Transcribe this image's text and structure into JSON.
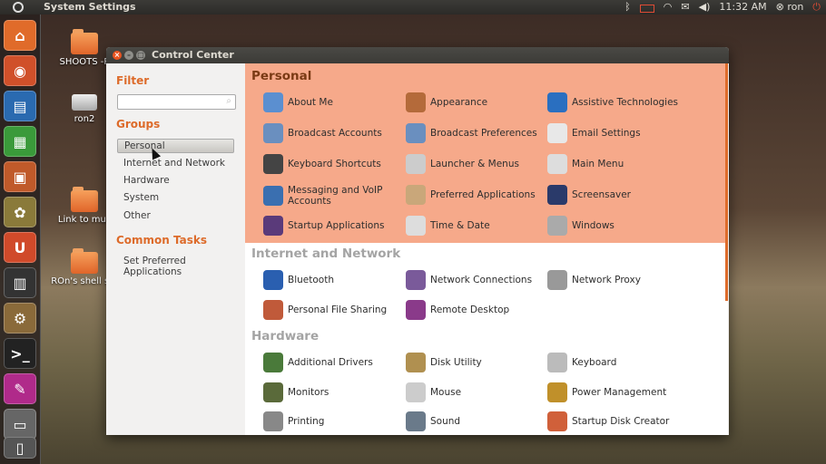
{
  "top_panel": {
    "app_title": "System Settings",
    "clock": "11:32 AM",
    "user": "ron"
  },
  "desktop": {
    "icons": [
      {
        "label": "SHOOTS -P"
      },
      {
        "label": "ron2"
      },
      {
        "label": "Link to mus"
      },
      {
        "label": "ROn's shell scr"
      }
    ]
  },
  "window": {
    "title": "Control Center",
    "sidebar": {
      "filter_heading": "Filter",
      "filter_value": "",
      "groups_heading": "Groups",
      "groups": [
        "Personal",
        "Internet and Network",
        "Hardware",
        "System",
        "Other"
      ],
      "selected_group": "Personal",
      "common_tasks_heading": "Common Tasks",
      "common_tasks": [
        "Set Preferred Applications"
      ]
    },
    "sections": [
      {
        "title": "Personal",
        "items": [
          {
            "label": "About Me",
            "icon": "about-me-icon",
            "color": "#5b8fd0"
          },
          {
            "label": "Appearance",
            "icon": "appearance-icon",
            "color": "#b46a3a"
          },
          {
            "label": "Assistive Technologies",
            "icon": "accessibility-icon",
            "color": "#2a6fc0"
          },
          {
            "label": "Broadcast Accounts",
            "icon": "broadcast-icon",
            "color": "#6a8fbf"
          },
          {
            "label": "Broadcast Preferences",
            "icon": "broadcast-prefs-icon",
            "color": "#6a8fbf"
          },
          {
            "label": "Email Settings",
            "icon": "email-icon",
            "color": "#e8e8e8"
          },
          {
            "label": "Keyboard Shortcuts",
            "icon": "keyboard-shortcuts-icon",
            "color": "#444"
          },
          {
            "label": "Launcher & Menus",
            "icon": "launcher-icon",
            "color": "#ccc"
          },
          {
            "label": "Main Menu",
            "icon": "main-menu-icon",
            "color": "#ddd"
          },
          {
            "label": "Messaging and VoIP\nAccounts",
            "icon": "messaging-icon",
            "color": "#3a6fb0"
          },
          {
            "label": "Preferred Applications",
            "icon": "preferred-apps-icon",
            "color": "#c9a77a"
          },
          {
            "label": "Screensaver",
            "icon": "screensaver-icon",
            "color": "#2a3a6a"
          },
          {
            "label": "Startup Applications",
            "icon": "startup-apps-icon",
            "color": "#5a3a7a"
          },
          {
            "label": "Time & Date",
            "icon": "clock-icon",
            "color": "#ddd"
          },
          {
            "label": "Windows",
            "icon": "windows-icon",
            "color": "#aaa"
          }
        ]
      },
      {
        "title": "Internet and Network",
        "items": [
          {
            "label": "Bluetooth",
            "icon": "bluetooth-icon",
            "color": "#2a5fb0"
          },
          {
            "label": "Network Connections",
            "icon": "network-connections-icon",
            "color": "#7a5a9a"
          },
          {
            "label": "Network Proxy",
            "icon": "network-proxy-icon",
            "color": "#999"
          },
          {
            "label": "Personal File Sharing",
            "icon": "file-sharing-icon",
            "color": "#c05a3a"
          },
          {
            "label": "Remote Desktop",
            "icon": "remote-desktop-icon",
            "color": "#8a3a8a"
          }
        ]
      },
      {
        "title": "Hardware",
        "items": [
          {
            "label": "Additional Drivers",
            "icon": "drivers-icon",
            "color": "#4a7a3a"
          },
          {
            "label": "Disk Utility",
            "icon": "disk-utility-icon",
            "color": "#b09050"
          },
          {
            "label": "Keyboard",
            "icon": "keyboard-icon",
            "color": "#bbb"
          },
          {
            "label": "Monitors",
            "icon": "monitor-icon",
            "color": "#5a6a3a"
          },
          {
            "label": "Mouse",
            "icon": "mouse-icon",
            "color": "#ccc"
          },
          {
            "label": "Power Management",
            "icon": "power-icon",
            "color": "#c0902a"
          },
          {
            "label": "Printing",
            "icon": "printer-icon",
            "color": "#888"
          },
          {
            "label": "Sound",
            "icon": "sound-icon",
            "color": "#6a7a8a"
          },
          {
            "label": "Startup Disk Creator",
            "icon": "startup-disk-icon",
            "color": "#d0603a"
          }
        ]
      }
    ]
  },
  "colors": {
    "accent": "#dd6b2a",
    "personal_bg": "#f6a98a"
  }
}
